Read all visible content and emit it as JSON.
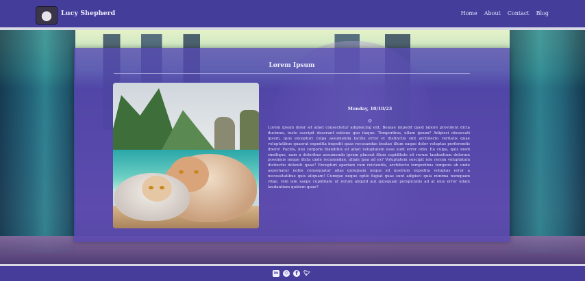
{
  "header": {
    "site_title": "Lucy Shepherd",
    "nav": [
      "Home",
      "About",
      "Contact",
      "Blog"
    ]
  },
  "post": {
    "title": "Lorem Ipsum",
    "date": "Monday, 10/10/23",
    "body": "Lorem ipsum dolor sit amet consectetur adipisicing elit. Beatae impedit quod labore provident dicta ducimus, iusto suscipit deserunt ratione quo itaque. Temporibus, ullam ipsum? Adipisci obcaecati ipsum, quis excepturi culpa assumenda facilis error et distinctio sint architecto veritatis quae voluptatibus quaerat expedita impedit quas recusandae beatae illum eaque dolor voluptas perferendis libero! Facilis, nisi corporis blanditiis sit amet voluptatem esse sunt error odio. Ea culpa, quis modi similique, nam a doloribus assumenda ipsum placeat illum cupiditate sit rerum laudantium dolorum possimus neque dicta unde recusandae, ullam ipsa ad ex? Voluptatem suscipit iste rerum voluptatum distinctio deleniti quae? Excepturi aperiam cum reiciendis, architecto temporibus tempora ab unde aspernatur nobis consequatur alias quisquam neque sit nostrum expedita voluptas error a necessitatibus quis aliquam! Cumque neque optio fugiat quas sunt adipisci quia minima numquam vitae, rem iste saepe cupiditate ut rerum aliquid aut quisquam perspiciatis ad at eius error ullam laudantium quidem quae?"
  },
  "footer": {
    "social_icons": [
      "linkedin-icon",
      "github-icon",
      "facebook-icon",
      "twitter-icon"
    ]
  },
  "colors": {
    "header_bg": "#483ea0",
    "card_bg": "#5648b2",
    "rule": "#d9d9e6"
  }
}
